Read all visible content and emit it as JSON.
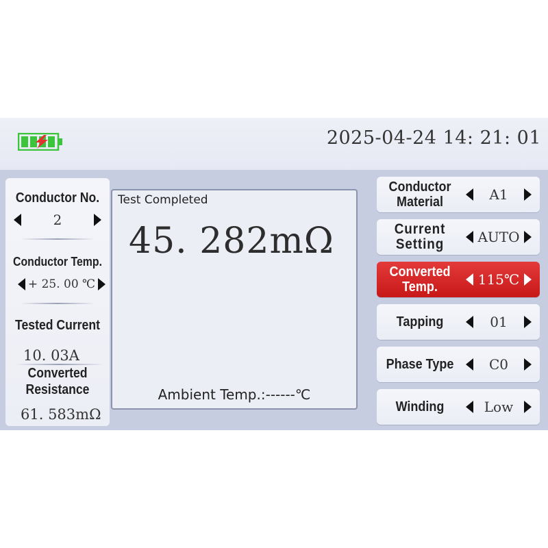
{
  "header": {
    "datetime": "2025-04-24 14: 21: 01",
    "battery_color": "#3cc43c",
    "charging_color": "#e63030"
  },
  "left": {
    "conductor_no_label": "Conductor No.",
    "conductor_no_value": "2",
    "conductor_temp_label": "Conductor Temp.",
    "conductor_temp_value": "+ 25. 00 ℃",
    "tested_current_label": "Tested Current",
    "tested_current_value": "10. 03A",
    "converted_resistance_label_1": "Converted",
    "converted_resistance_label_2": "Resistance",
    "converted_resistance_value": "61. 583mΩ"
  },
  "center": {
    "status": "Test Completed",
    "reading": "45. 282mΩ",
    "ambient": "Ambient Temp.:------℃"
  },
  "right": {
    "items": [
      {
        "label_1": "Conductor",
        "label_2": "Material",
        "value": "A1"
      },
      {
        "label_1": "Current",
        "label_2": "Setting",
        "value": "AUTO"
      },
      {
        "label_1": "Converted",
        "label_2": "Temp.",
        "value": "115℃"
      },
      {
        "label_1": "Tapping",
        "label_2": "",
        "value": "01"
      },
      {
        "label_1": "Phase Type",
        "label_2": "",
        "value": "C0"
      },
      {
        "label_1": "Winding",
        "label_2": "",
        "value": "Low"
      }
    ],
    "active_color": "#d42222"
  }
}
